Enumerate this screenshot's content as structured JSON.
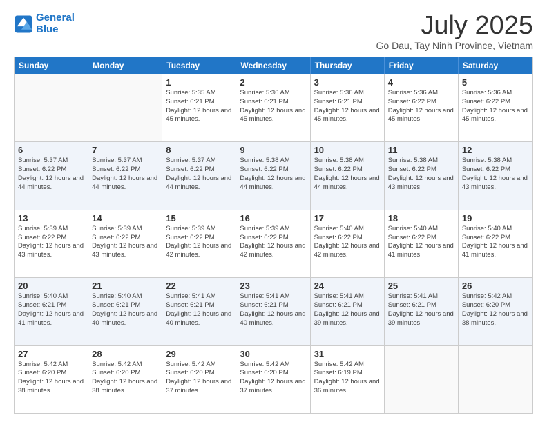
{
  "logo": {
    "line1": "General",
    "line2": "Blue"
  },
  "title": "July 2025",
  "subtitle": "Go Dau, Tay Ninh Province, Vietnam",
  "days": [
    "Sunday",
    "Monday",
    "Tuesday",
    "Wednesday",
    "Thursday",
    "Friday",
    "Saturday"
  ],
  "weeks": [
    [
      {
        "day": "",
        "info": ""
      },
      {
        "day": "",
        "info": ""
      },
      {
        "day": "1",
        "info": "Sunrise: 5:35 AM\nSunset: 6:21 PM\nDaylight: 12 hours and 45 minutes."
      },
      {
        "day": "2",
        "info": "Sunrise: 5:36 AM\nSunset: 6:21 PM\nDaylight: 12 hours and 45 minutes."
      },
      {
        "day": "3",
        "info": "Sunrise: 5:36 AM\nSunset: 6:21 PM\nDaylight: 12 hours and 45 minutes."
      },
      {
        "day": "4",
        "info": "Sunrise: 5:36 AM\nSunset: 6:22 PM\nDaylight: 12 hours and 45 minutes."
      },
      {
        "day": "5",
        "info": "Sunrise: 5:36 AM\nSunset: 6:22 PM\nDaylight: 12 hours and 45 minutes."
      }
    ],
    [
      {
        "day": "6",
        "info": "Sunrise: 5:37 AM\nSunset: 6:22 PM\nDaylight: 12 hours and 44 minutes."
      },
      {
        "day": "7",
        "info": "Sunrise: 5:37 AM\nSunset: 6:22 PM\nDaylight: 12 hours and 44 minutes."
      },
      {
        "day": "8",
        "info": "Sunrise: 5:37 AM\nSunset: 6:22 PM\nDaylight: 12 hours and 44 minutes."
      },
      {
        "day": "9",
        "info": "Sunrise: 5:38 AM\nSunset: 6:22 PM\nDaylight: 12 hours and 44 minutes."
      },
      {
        "day": "10",
        "info": "Sunrise: 5:38 AM\nSunset: 6:22 PM\nDaylight: 12 hours and 44 minutes."
      },
      {
        "day": "11",
        "info": "Sunrise: 5:38 AM\nSunset: 6:22 PM\nDaylight: 12 hours and 43 minutes."
      },
      {
        "day": "12",
        "info": "Sunrise: 5:38 AM\nSunset: 6:22 PM\nDaylight: 12 hours and 43 minutes."
      }
    ],
    [
      {
        "day": "13",
        "info": "Sunrise: 5:39 AM\nSunset: 6:22 PM\nDaylight: 12 hours and 43 minutes."
      },
      {
        "day": "14",
        "info": "Sunrise: 5:39 AM\nSunset: 6:22 PM\nDaylight: 12 hours and 43 minutes."
      },
      {
        "day": "15",
        "info": "Sunrise: 5:39 AM\nSunset: 6:22 PM\nDaylight: 12 hours and 42 minutes."
      },
      {
        "day": "16",
        "info": "Sunrise: 5:39 AM\nSunset: 6:22 PM\nDaylight: 12 hours and 42 minutes."
      },
      {
        "day": "17",
        "info": "Sunrise: 5:40 AM\nSunset: 6:22 PM\nDaylight: 12 hours and 42 minutes."
      },
      {
        "day": "18",
        "info": "Sunrise: 5:40 AM\nSunset: 6:22 PM\nDaylight: 12 hours and 41 minutes."
      },
      {
        "day": "19",
        "info": "Sunrise: 5:40 AM\nSunset: 6:22 PM\nDaylight: 12 hours and 41 minutes."
      }
    ],
    [
      {
        "day": "20",
        "info": "Sunrise: 5:40 AM\nSunset: 6:21 PM\nDaylight: 12 hours and 41 minutes."
      },
      {
        "day": "21",
        "info": "Sunrise: 5:40 AM\nSunset: 6:21 PM\nDaylight: 12 hours and 40 minutes."
      },
      {
        "day": "22",
        "info": "Sunrise: 5:41 AM\nSunset: 6:21 PM\nDaylight: 12 hours and 40 minutes."
      },
      {
        "day": "23",
        "info": "Sunrise: 5:41 AM\nSunset: 6:21 PM\nDaylight: 12 hours and 40 minutes."
      },
      {
        "day": "24",
        "info": "Sunrise: 5:41 AM\nSunset: 6:21 PM\nDaylight: 12 hours and 39 minutes."
      },
      {
        "day": "25",
        "info": "Sunrise: 5:41 AM\nSunset: 6:21 PM\nDaylight: 12 hours and 39 minutes."
      },
      {
        "day": "26",
        "info": "Sunrise: 5:42 AM\nSunset: 6:20 PM\nDaylight: 12 hours and 38 minutes."
      }
    ],
    [
      {
        "day": "27",
        "info": "Sunrise: 5:42 AM\nSunset: 6:20 PM\nDaylight: 12 hours and 38 minutes."
      },
      {
        "day": "28",
        "info": "Sunrise: 5:42 AM\nSunset: 6:20 PM\nDaylight: 12 hours and 38 minutes."
      },
      {
        "day": "29",
        "info": "Sunrise: 5:42 AM\nSunset: 6:20 PM\nDaylight: 12 hours and 37 minutes."
      },
      {
        "day": "30",
        "info": "Sunrise: 5:42 AM\nSunset: 6:20 PM\nDaylight: 12 hours and 37 minutes."
      },
      {
        "day": "31",
        "info": "Sunrise: 5:42 AM\nSunset: 6:19 PM\nDaylight: 12 hours and 36 minutes."
      },
      {
        "day": "",
        "info": ""
      },
      {
        "day": "",
        "info": ""
      }
    ]
  ]
}
